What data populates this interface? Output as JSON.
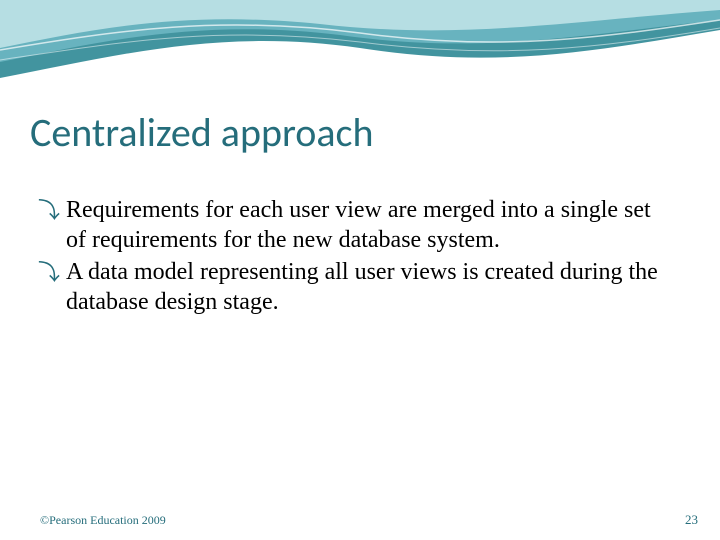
{
  "slide": {
    "title": "Centralized approach",
    "bullets": [
      "Requirements for each user view are merged into a single set of requirements for the new database system.",
      "A data model representing all user views is created during the database design stage."
    ],
    "footer_left": "©Pearson Education 2009",
    "page_number": "23"
  }
}
